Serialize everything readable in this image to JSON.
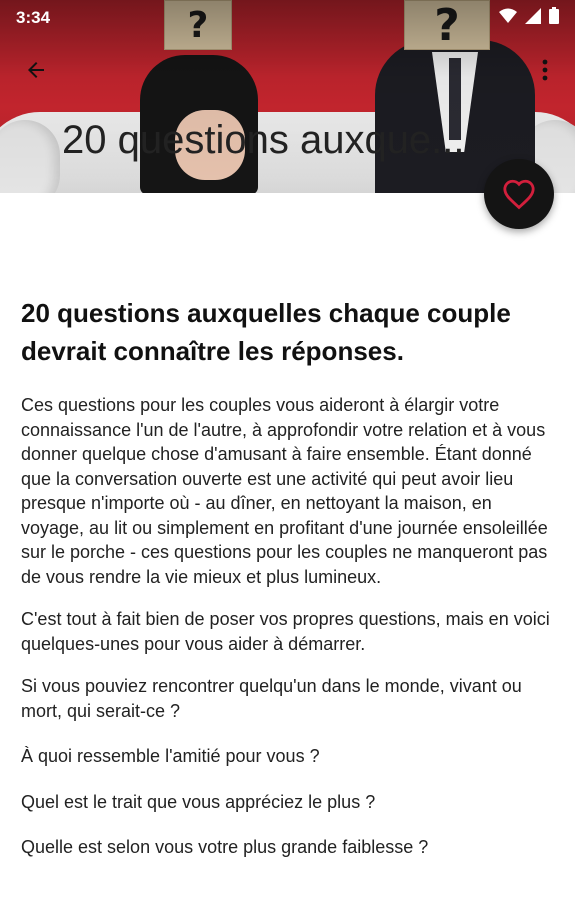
{
  "status_bar": {
    "time": "3:34",
    "icons": [
      "wifi-icon",
      "cellular-signal-icon",
      "battery-icon"
    ]
  },
  "header": {
    "image_subject": "couple with box heads on sofa",
    "box_left_mark": "?",
    "box_right_mark": "?",
    "collapsed_title": "20 questions auxque..."
  },
  "toolbar": {
    "back_icon": "arrow-back-icon",
    "more_icon": "more-vertical-icon"
  },
  "fab": {
    "icon": "heart-outline-icon",
    "accent_color": "#d21f3c"
  },
  "article": {
    "title": "20 questions auxquelles chaque couple devrait connaître les réponses.",
    "paragraphs": [
      "Ces questions pour les couples vous aideront à élargir votre connaissance l'un de l'autre, à approfondir votre relation et à vous donner quelque chose d'amusant à faire ensemble. Étant donné que la conversation ouverte est une activité qui peut avoir lieu presque n'importe où - au dîner, en nettoyant la maison, en voyage, au lit ou simplement en profitant d'une journée ensoleillée sur le porche - ces questions pour les couples ne manqueront pas de vous rendre la vie mieux et plus lumineux.",
      "C'est tout à fait bien de poser vos propres questions, mais en voici quelques-unes pour vous aider à démarrer.",
      "Si vous pouviez rencontrer quelqu'un dans le monde, vivant ou mort, qui serait-ce ?",
      "À quoi ressemble l'amitié pour vous ?",
      "Quel est le trait que vous appréciez le plus ?",
      "Quelle est selon vous votre plus grande faiblesse ?"
    ]
  }
}
